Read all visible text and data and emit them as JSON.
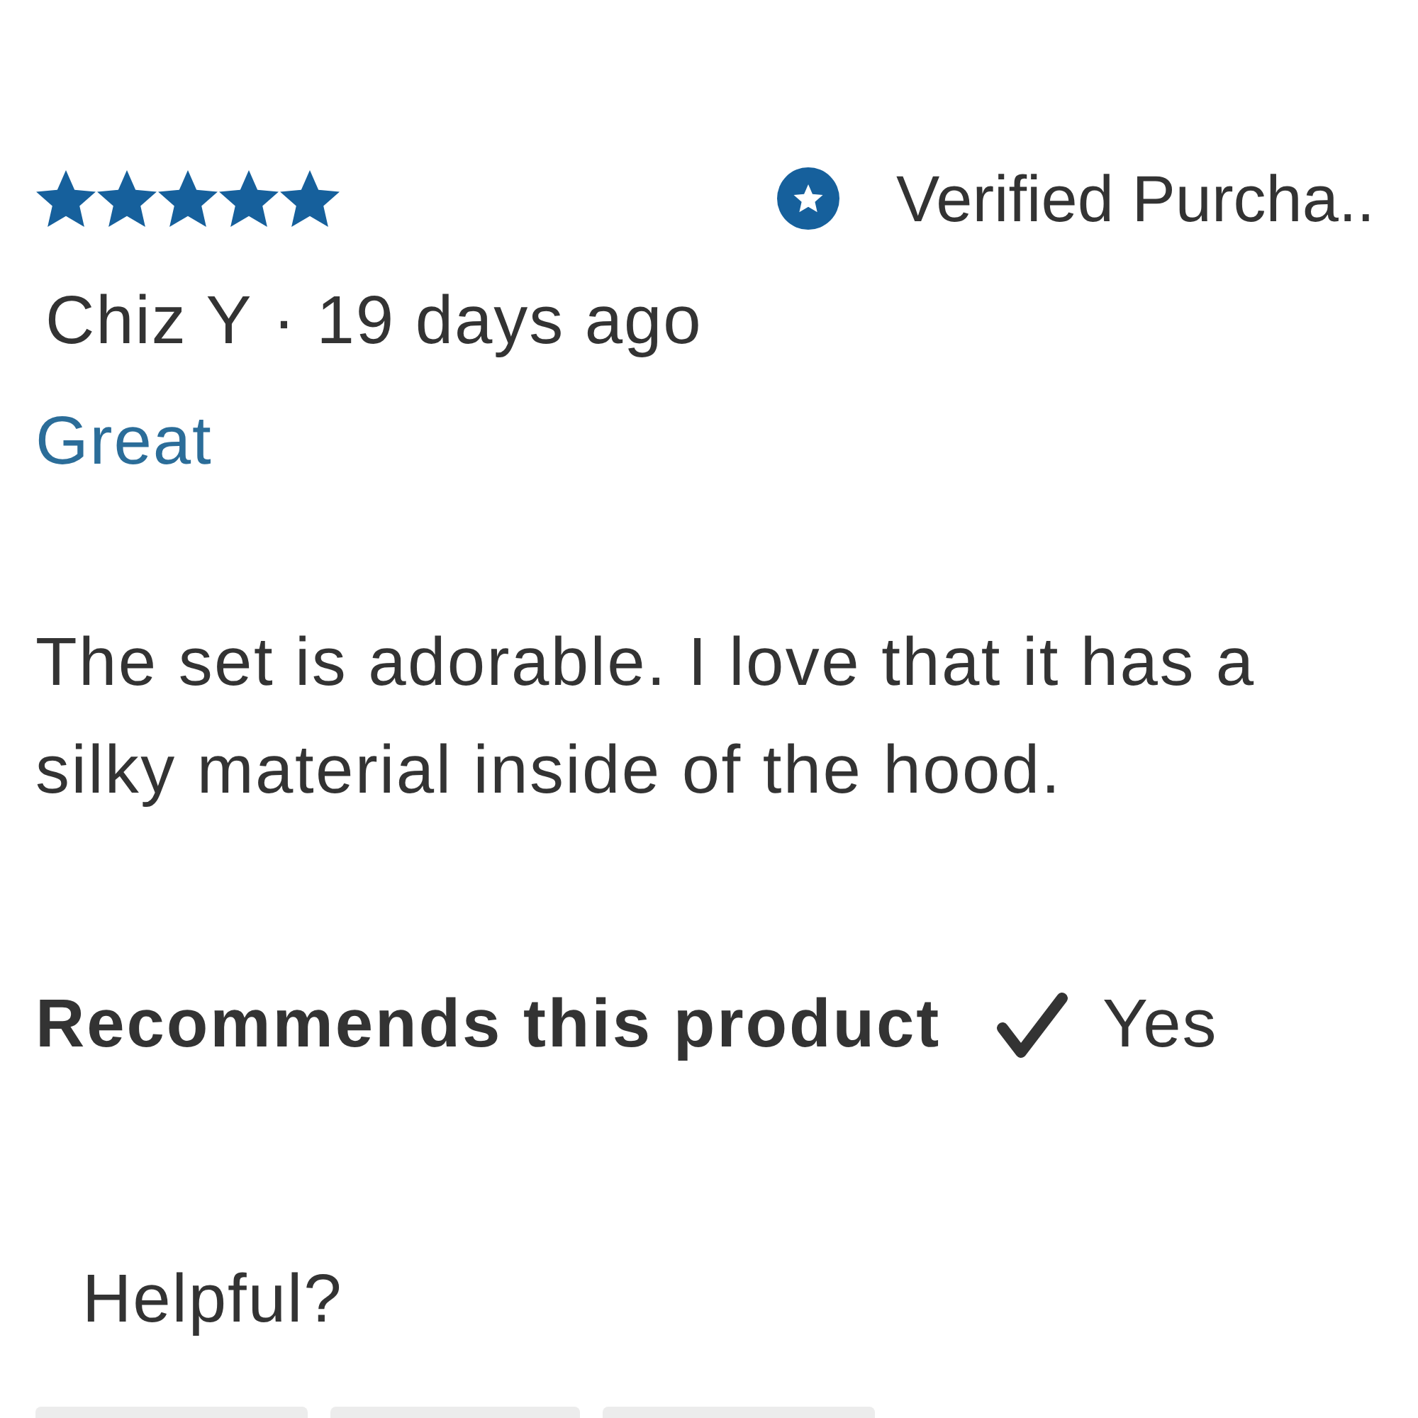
{
  "review": {
    "stars": 5,
    "verified": "Verified Purcha..",
    "author": "Chiz Y",
    "separator": "·",
    "date": "19 days ago",
    "title": "Great",
    "body": "The set is adorable. I love that it has a silky material inside of the hood."
  },
  "recommendation": {
    "label": "Recommends this product",
    "recommended": true,
    "answer": "Yes"
  },
  "helpful": {
    "label": "Helpful?"
  }
}
